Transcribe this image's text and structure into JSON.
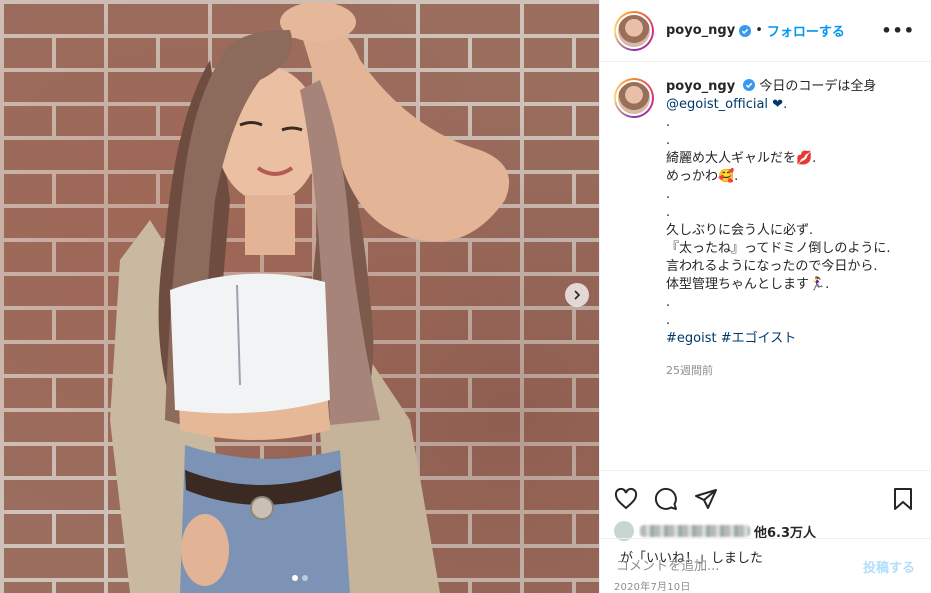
{
  "post": {
    "username": "poyo_ngy",
    "separator": "•",
    "follow_label": "フォローする",
    "more_label": "•••"
  },
  "caption": {
    "username": "poyo_ngy",
    "lines": [
      "今日のコーデは全身",
      "@egoist_official ❤.",
      ".",
      ".",
      "綺麗め大人ギャルだを💋.",
      "めっかわ🥰.",
      ".",
      ".",
      "久しぶりに会う人に必ず.",
      "『太ったね』ってドミノ倒しのように.",
      "言われるようになったので今日から.",
      "体型管理ちゃんとします🏃‍♀️.",
      ".",
      "."
    ],
    "hashtags": "#egoist #エゴイスト",
    "time_ago": "25週間前"
  },
  "likes": {
    "others": "他6.3万人",
    "liked_line": "が「いいね！」しました"
  },
  "date": "2020年7月10日",
  "comment": {
    "placeholder": "コメントを追加...",
    "post_label": "投稿する"
  },
  "colors": {
    "accent": "#0095f6",
    "verified": "#3897f0",
    "post_disabled": "#b2dffc",
    "hashtag": "#00376b"
  },
  "carousel": {
    "total_dots": 2,
    "active_index": 0
  }
}
